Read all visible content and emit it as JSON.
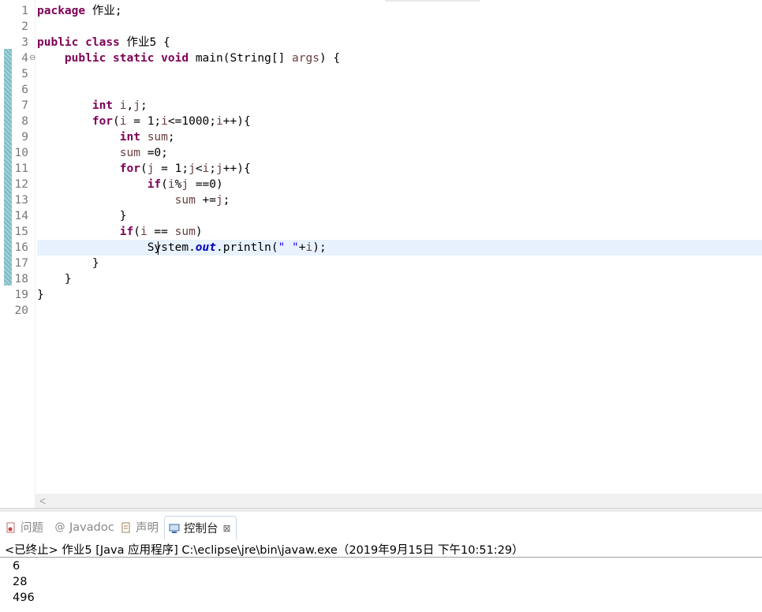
{
  "editor": {
    "lines": [
      {
        "num": "1",
        "fold": "",
        "parts": [
          {
            "t": "package",
            "c": "kw"
          },
          {
            "t": " "
          },
          {
            "t": "作业",
            "c": "cjk"
          },
          {
            "t": ";"
          }
        ]
      },
      {
        "num": "2",
        "fold": "",
        "parts": []
      },
      {
        "num": "3",
        "fold": "",
        "parts": [
          {
            "t": "public",
            "c": "kw"
          },
          {
            "t": " "
          },
          {
            "t": "class",
            "c": "kw"
          },
          {
            "t": " "
          },
          {
            "t": "作业",
            "c": "cjk"
          },
          {
            "t": "5 {"
          }
        ]
      },
      {
        "num": "4",
        "fold": "⊖",
        "parts": [
          {
            "t": "    "
          },
          {
            "t": "public",
            "c": "kw"
          },
          {
            "t": " "
          },
          {
            "t": "static",
            "c": "kw"
          },
          {
            "t": " "
          },
          {
            "t": "void",
            "c": "kw"
          },
          {
            "t": " main(String[] "
          },
          {
            "t": "args",
            "c": "var"
          },
          {
            "t": ") {"
          }
        ]
      },
      {
        "num": "5",
        "fold": "",
        "parts": []
      },
      {
        "num": "6",
        "fold": "",
        "parts": []
      },
      {
        "num": "7",
        "fold": "",
        "parts": [
          {
            "t": "        "
          },
          {
            "t": "int",
            "c": "kw"
          },
          {
            "t": " "
          },
          {
            "t": "i",
            "c": "var"
          },
          {
            "t": ","
          },
          {
            "t": "j",
            "c": "var"
          },
          {
            "t": ";"
          }
        ]
      },
      {
        "num": "8",
        "fold": "",
        "parts": [
          {
            "t": "        "
          },
          {
            "t": "for",
            "c": "kw"
          },
          {
            "t": "("
          },
          {
            "t": "i",
            "c": "var"
          },
          {
            "t": " = 1;"
          },
          {
            "t": "i",
            "c": "var"
          },
          {
            "t": "<=1000;"
          },
          {
            "t": "i",
            "c": "var"
          },
          {
            "t": "++){"
          }
        ]
      },
      {
        "num": "9",
        "fold": "",
        "parts": [
          {
            "t": "            "
          },
          {
            "t": "int",
            "c": "kw"
          },
          {
            "t": " "
          },
          {
            "t": "sum",
            "c": "var"
          },
          {
            "t": ";"
          }
        ]
      },
      {
        "num": "10",
        "fold": "",
        "parts": [
          {
            "t": "            "
          },
          {
            "t": "sum",
            "c": "var"
          },
          {
            "t": " =0;"
          }
        ]
      },
      {
        "num": "11",
        "fold": "",
        "parts": [
          {
            "t": "            "
          },
          {
            "t": "for",
            "c": "kw"
          },
          {
            "t": "("
          },
          {
            "t": "j",
            "c": "var"
          },
          {
            "t": " = 1;"
          },
          {
            "t": "j",
            "c": "var"
          },
          {
            "t": "<"
          },
          {
            "t": "i",
            "c": "var"
          },
          {
            "t": ";"
          },
          {
            "t": "j",
            "c": "var"
          },
          {
            "t": "++){"
          }
        ]
      },
      {
        "num": "12",
        "fold": "",
        "parts": [
          {
            "t": "                "
          },
          {
            "t": "if",
            "c": "kw"
          },
          {
            "t": "("
          },
          {
            "t": "i",
            "c": "var"
          },
          {
            "t": "%"
          },
          {
            "t": "j",
            "c": "var"
          },
          {
            "t": " ==0)"
          }
        ]
      },
      {
        "num": "13",
        "fold": "",
        "parts": [
          {
            "t": "                    "
          },
          {
            "t": "sum",
            "c": "var"
          },
          {
            "t": " +="
          },
          {
            "t": "j",
            "c": "var"
          },
          {
            "t": ";"
          }
        ]
      },
      {
        "num": "14",
        "fold": "",
        "parts": [
          {
            "t": "            }"
          }
        ]
      },
      {
        "num": "15",
        "fold": "",
        "parts": [
          {
            "t": "            "
          },
          {
            "t": "if",
            "c": "kw"
          },
          {
            "t": "("
          },
          {
            "t": "i",
            "c": "var"
          },
          {
            "t": " == "
          },
          {
            "t": "sum",
            "c": "var"
          },
          {
            "t": ")"
          }
        ]
      },
      {
        "num": "16",
        "fold": "",
        "current": true,
        "parts": [
          {
            "t": "                "
          },
          {
            "t": "System."
          },
          {
            "t": "out",
            "c": "fld"
          },
          {
            "t": ".println("
          },
          {
            "t": "\" \"",
            "c": "str"
          },
          {
            "t": "+"
          },
          {
            "t": "i",
            "c": "var"
          },
          {
            "t": ");"
          }
        ]
      },
      {
        "num": "17",
        "fold": "",
        "parts": [
          {
            "t": "        }"
          }
        ]
      },
      {
        "num": "18",
        "fold": "",
        "parts": [
          {
            "t": "    }"
          }
        ]
      },
      {
        "num": "19",
        "fold": "",
        "parts": [
          {
            "t": "}"
          }
        ]
      },
      {
        "num": "20",
        "fold": "",
        "parts": []
      }
    ],
    "scroll_left_icon": "chevron-left-icon"
  },
  "panel": {
    "tabs": [
      {
        "label": "问题",
        "icon": "problems-icon",
        "active": false
      },
      {
        "label": "Javadoc",
        "icon": "at-icon",
        "active": false
      },
      {
        "label": "声明",
        "icon": "declaration-icon",
        "active": false
      },
      {
        "label": "控制台",
        "icon": "console-icon",
        "active": true
      }
    ],
    "close_glyph": "⊠",
    "console_header": "<已终止> 作业5 [Java 应用程序] C:\\eclipse\\jre\\bin\\javaw.exe（2019年9月15日 下午10:51:29）",
    "output": [
      "6",
      "28",
      "496"
    ]
  },
  "colors": {
    "keyword": "#7f0055",
    "variable": "#6a3e3e",
    "string": "#2a00ff",
    "field": "#0000c0",
    "current_line": "#e8f2fe"
  }
}
